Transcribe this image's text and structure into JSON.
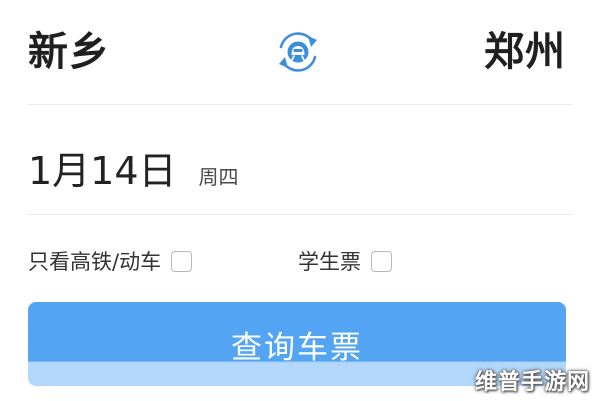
{
  "route": {
    "from_station": "新乡",
    "to_station": "郑州",
    "swap_icon": "train-swap-icon"
  },
  "date": {
    "date_text": "1月14日",
    "weekday": "周四"
  },
  "options": {
    "highspeed_label": "只看高铁/动车",
    "highspeed_checked": false,
    "student_label": "学生票",
    "student_checked": false
  },
  "search": {
    "button_label": "查询车票"
  },
  "watermark": "维普手游网",
  "colors": {
    "accent_blue": "#53a4f2",
    "icon_blue": "#3d8fd9"
  }
}
